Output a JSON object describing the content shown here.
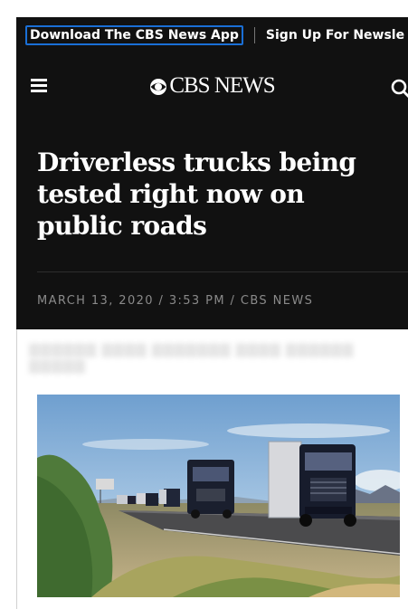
{
  "promo": {
    "app_link": "Download The CBS News App",
    "newsletter_link": "Sign Up For Newsle"
  },
  "header": {
    "logo_text": "CBS NEWS",
    "menu_icon": "hamburger-menu-icon",
    "search_icon": "search-icon"
  },
  "article": {
    "headline": "Driverless trucks being tested right now on public roads",
    "byline": "MARCH 13, 2020 / 3:53 PM / CBS NEWS"
  },
  "hero_image": {
    "subject": "semi trucks driving in convoy on a desert highway"
  },
  "colors": {
    "header_bg": "#111111",
    "focus_ring": "#1a6fd6",
    "byline": "#8a8a8a"
  }
}
